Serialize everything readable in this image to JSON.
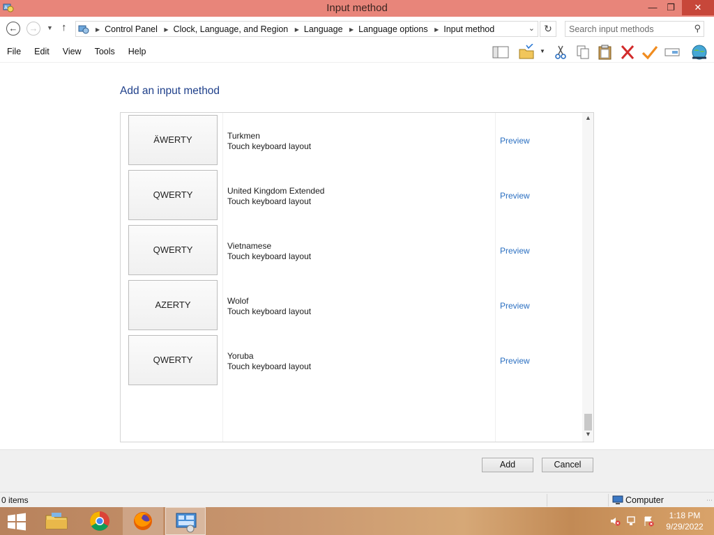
{
  "window": {
    "title": "Input method"
  },
  "address": {
    "crumbs": [
      "Control Panel",
      "Clock, Language, and Region",
      "Language",
      "Language options",
      "Input method"
    ],
    "search_placeholder": "Search input methods"
  },
  "menu": [
    "File",
    "Edit",
    "View",
    "Tools",
    "Help"
  ],
  "content": {
    "heading": "Add an input method",
    "methods": [
      {
        "layout": "ÄWERTY",
        "name": "Turkmen",
        "type": "Touch keyboard layout",
        "preview": "Preview"
      },
      {
        "layout": "QWERTY",
        "name": "United Kingdom Extended",
        "type": "Touch keyboard layout",
        "preview": "Preview"
      },
      {
        "layout": "QWERTY",
        "name": "Vietnamese",
        "type": "Touch keyboard layout",
        "preview": "Preview"
      },
      {
        "layout": "AZERTY",
        "name": "Wolof",
        "type": "Touch keyboard layout",
        "preview": "Preview"
      },
      {
        "layout": "QWERTY",
        "name": "Yoruba",
        "type": "Touch keyboard layout",
        "preview": "Preview"
      }
    ]
  },
  "buttons": {
    "add": "Add",
    "cancel": "Cancel"
  },
  "status": {
    "items": "0 items",
    "location": "Computer"
  },
  "taskbar": {
    "time": "1:18 PM",
    "date": "9/29/2022"
  },
  "colors": {
    "titlebar": "#e8857a",
    "link": "#2a6fc1",
    "heading": "#1e3f8a"
  }
}
